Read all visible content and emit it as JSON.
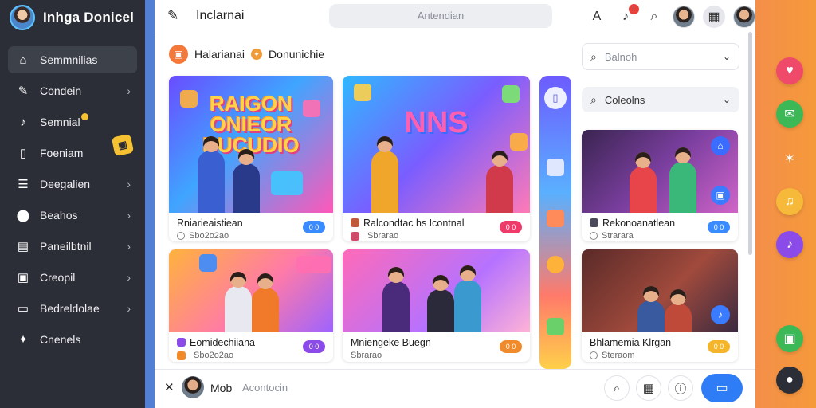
{
  "sidebar": {
    "brand_title": "Inhga Donicel",
    "items": [
      {
        "label": "Semmnilias",
        "icon": "home-icon",
        "glyph": "⌂",
        "active": true,
        "chevron": false
      },
      {
        "label": "Condein",
        "icon": "pencil-icon",
        "glyph": "✎",
        "active": false,
        "chevron": true
      },
      {
        "label": "Semnial",
        "icon": "music-icon",
        "glyph": "♪",
        "active": false,
        "chevron": false
      },
      {
        "label": "Foeniam",
        "icon": "file-icon",
        "glyph": "▯",
        "active": false,
        "chevron": false
      },
      {
        "label": "Deegalien",
        "icon": "list-icon",
        "glyph": "☰",
        "active": false,
        "chevron": true
      },
      {
        "label": "Beahos",
        "icon": "location-pin-icon",
        "glyph": "⬤",
        "active": false,
        "chevron": true
      },
      {
        "label": "Paneilbtnil",
        "icon": "document-icon",
        "glyph": "▤",
        "active": false,
        "chevron": true
      },
      {
        "label": "Creopil",
        "icon": "image-icon",
        "glyph": "▣",
        "active": false,
        "chevron": true
      },
      {
        "label": "Bedreldolae",
        "icon": "folder-icon",
        "glyph": "▭",
        "active": false,
        "chevron": true
      },
      {
        "label": "Cnenels",
        "icon": "shapes-icon",
        "glyph": "✦",
        "active": false,
        "chevron": false
      }
    ]
  },
  "header": {
    "title": "Inclarnai",
    "search_placeholder": "Antendian",
    "notification_count": "!"
  },
  "section": {
    "title": "Halarianai",
    "subtitle": "Donunichie"
  },
  "filters": {
    "first": {
      "label": "Balnoh"
    },
    "second": {
      "label": "Coleolns"
    }
  },
  "cards": [
    {
      "title": "Rniarieaistiean",
      "meta": "Sbo2o2ao",
      "pill": "0 0",
      "pill_color": "#3a8bff",
      "banner": "RAIGON\nONIEOR\nNUCUDIO"
    },
    {
      "title": "Ralcondtac hs Icontnal",
      "meta": "Sbrarao",
      "pill": "0 0",
      "pill_color": "#ef3a6a",
      "banner": "NNS"
    },
    {
      "title": "Rekonoanatlean",
      "meta": "Strarara",
      "pill": "0 0",
      "pill_color": "#3a8bff",
      "banner": ""
    },
    {
      "title": "Eomidechiiana",
      "meta": "Sbo2o2ao",
      "pill": "0 0",
      "pill_color": "#8a4be8",
      "banner": ""
    },
    {
      "title": "Mniengeke Buegn",
      "meta": "Sbrarao",
      "pill": "0 0",
      "pill_color": "#f08a2a",
      "banner": ""
    },
    {
      "title": "Bhlamemia Klrgan",
      "meta": "Steraom",
      "pill": "0 0",
      "pill_color": "#f5b52a",
      "banner": ""
    }
  ],
  "bottombar": {
    "user_name": "Mob",
    "input_placeholder": "Acontocin"
  },
  "colors": {
    "sidebar_bg": "#2b2e36",
    "accent_blue": "#2f7df6",
    "accent_orange": "#f4783a"
  },
  "rail": [
    {
      "icon": "heart-icon",
      "color": "#ef4a6a",
      "glyph": "♥"
    },
    {
      "icon": "chat-icon",
      "color": "#3cb857",
      "glyph": "✉"
    },
    {
      "icon": "star-icon",
      "color": "#f2a43a",
      "glyph": "✶"
    },
    {
      "icon": "music-note-icon",
      "color": "#f6b93a",
      "glyph": "♫"
    },
    {
      "icon": "music-icon",
      "color": "#8a4be8",
      "glyph": "♪"
    },
    {
      "icon": "game-icon",
      "color": "#3cb857",
      "glyph": "▣"
    },
    {
      "icon": "discord-icon",
      "color": "#2b2e36",
      "glyph": "●"
    }
  ]
}
